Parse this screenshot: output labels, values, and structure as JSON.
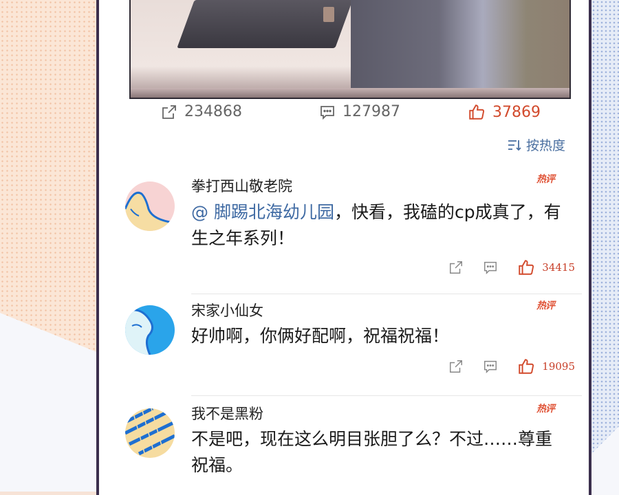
{
  "post": {
    "share_count": "234868",
    "comment_count": "127987",
    "like_count": "37869"
  },
  "sort": {
    "label": "按热度"
  },
  "hot_badge": "热评",
  "comments": [
    {
      "name": "拳打西山敬老院",
      "mention": "@ 脚踢北海幼儿园",
      "text": "，快看，我磕的cp成真了，有生之年系列！",
      "likes": "34415"
    },
    {
      "name": "宋家小仙女",
      "text": "好帅啊，你俩好配啊，祝福祝福！",
      "likes": "19095"
    },
    {
      "name": "我不是黑粉",
      "text": "不是吧，现在这么明目张胆了么？不过……尊重祝福。"
    }
  ],
  "colors": {
    "accent_like": "#d24a2c",
    "mention": "#3f6aa3",
    "hot": "#e05539"
  }
}
